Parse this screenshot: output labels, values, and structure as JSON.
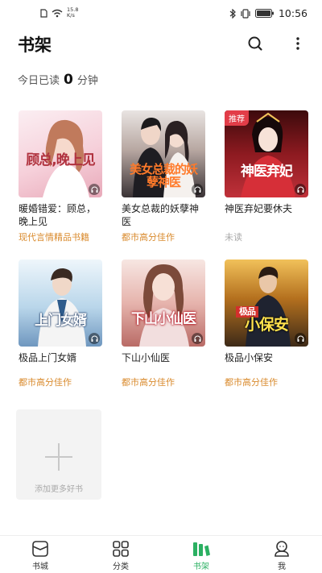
{
  "status_bar": {
    "speed_value": "15.8",
    "speed_unit": "K/s",
    "time": "10:56"
  },
  "header": {
    "title": "书架"
  },
  "reading": {
    "prefix": "今日已读",
    "minutes": "0",
    "unit": "分钟"
  },
  "books": [
    {
      "title": "暖婚错爱：顾总，晚上见",
      "tag": "现代言情精品书籍",
      "cover_text": "顾总,晚上见",
      "cover_colors": [
        "#fbe9ee",
        "#f3c6d2"
      ],
      "cover_text_color": "#b0323e"
    },
    {
      "title": "美女总裁的妖孽神医",
      "tag": "都市高分佳作",
      "cover_text": "美女总裁的妖孽神医",
      "cover_colors": [
        "#2b2b2e",
        "#8d6b66"
      ],
      "cover_text_color": "#ff7a2a"
    },
    {
      "title": "神医弃妃要休夫",
      "tag": "未读",
      "ribbon": "推荐",
      "cover_text": "神医弃妃",
      "cover_colors": [
        "#5a0c10",
        "#b5262d"
      ],
      "cover_text_color": "#ffffff"
    },
    {
      "title": "极品上门女婿",
      "tag": "都市高分佳作",
      "cover_text": "上门女婿",
      "cover_colors": [
        "#d8ecf7",
        "#8fb4d6"
      ],
      "cover_text_color": "#ffffff"
    },
    {
      "title": "下山小仙医",
      "tag": "都市高分佳作",
      "cover_text": "下山小仙医",
      "cover_colors": [
        "#f4d7d2",
        "#d28f88"
      ],
      "cover_text_color": "#ffffff"
    },
    {
      "title": "极品小保安",
      "tag": "都市高分佳作",
      "cover_text": "小保安",
      "cover_sub": "极品",
      "cover_colors": [
        "#5b3b20",
        "#c27a1d"
      ],
      "cover_text_color": "#ffe14d"
    }
  ],
  "add_more": {
    "label": "添加更多好书"
  },
  "nav": [
    {
      "label": "书城",
      "icon": "bookstore-icon",
      "active": false
    },
    {
      "label": "分类",
      "icon": "category-icon",
      "active": false
    },
    {
      "label": "书架",
      "icon": "bookshelf-icon",
      "active": true
    },
    {
      "label": "我",
      "icon": "profile-icon",
      "active": false
    }
  ],
  "colors": {
    "accent": "#2bb062",
    "tag": "#d98a2c"
  }
}
